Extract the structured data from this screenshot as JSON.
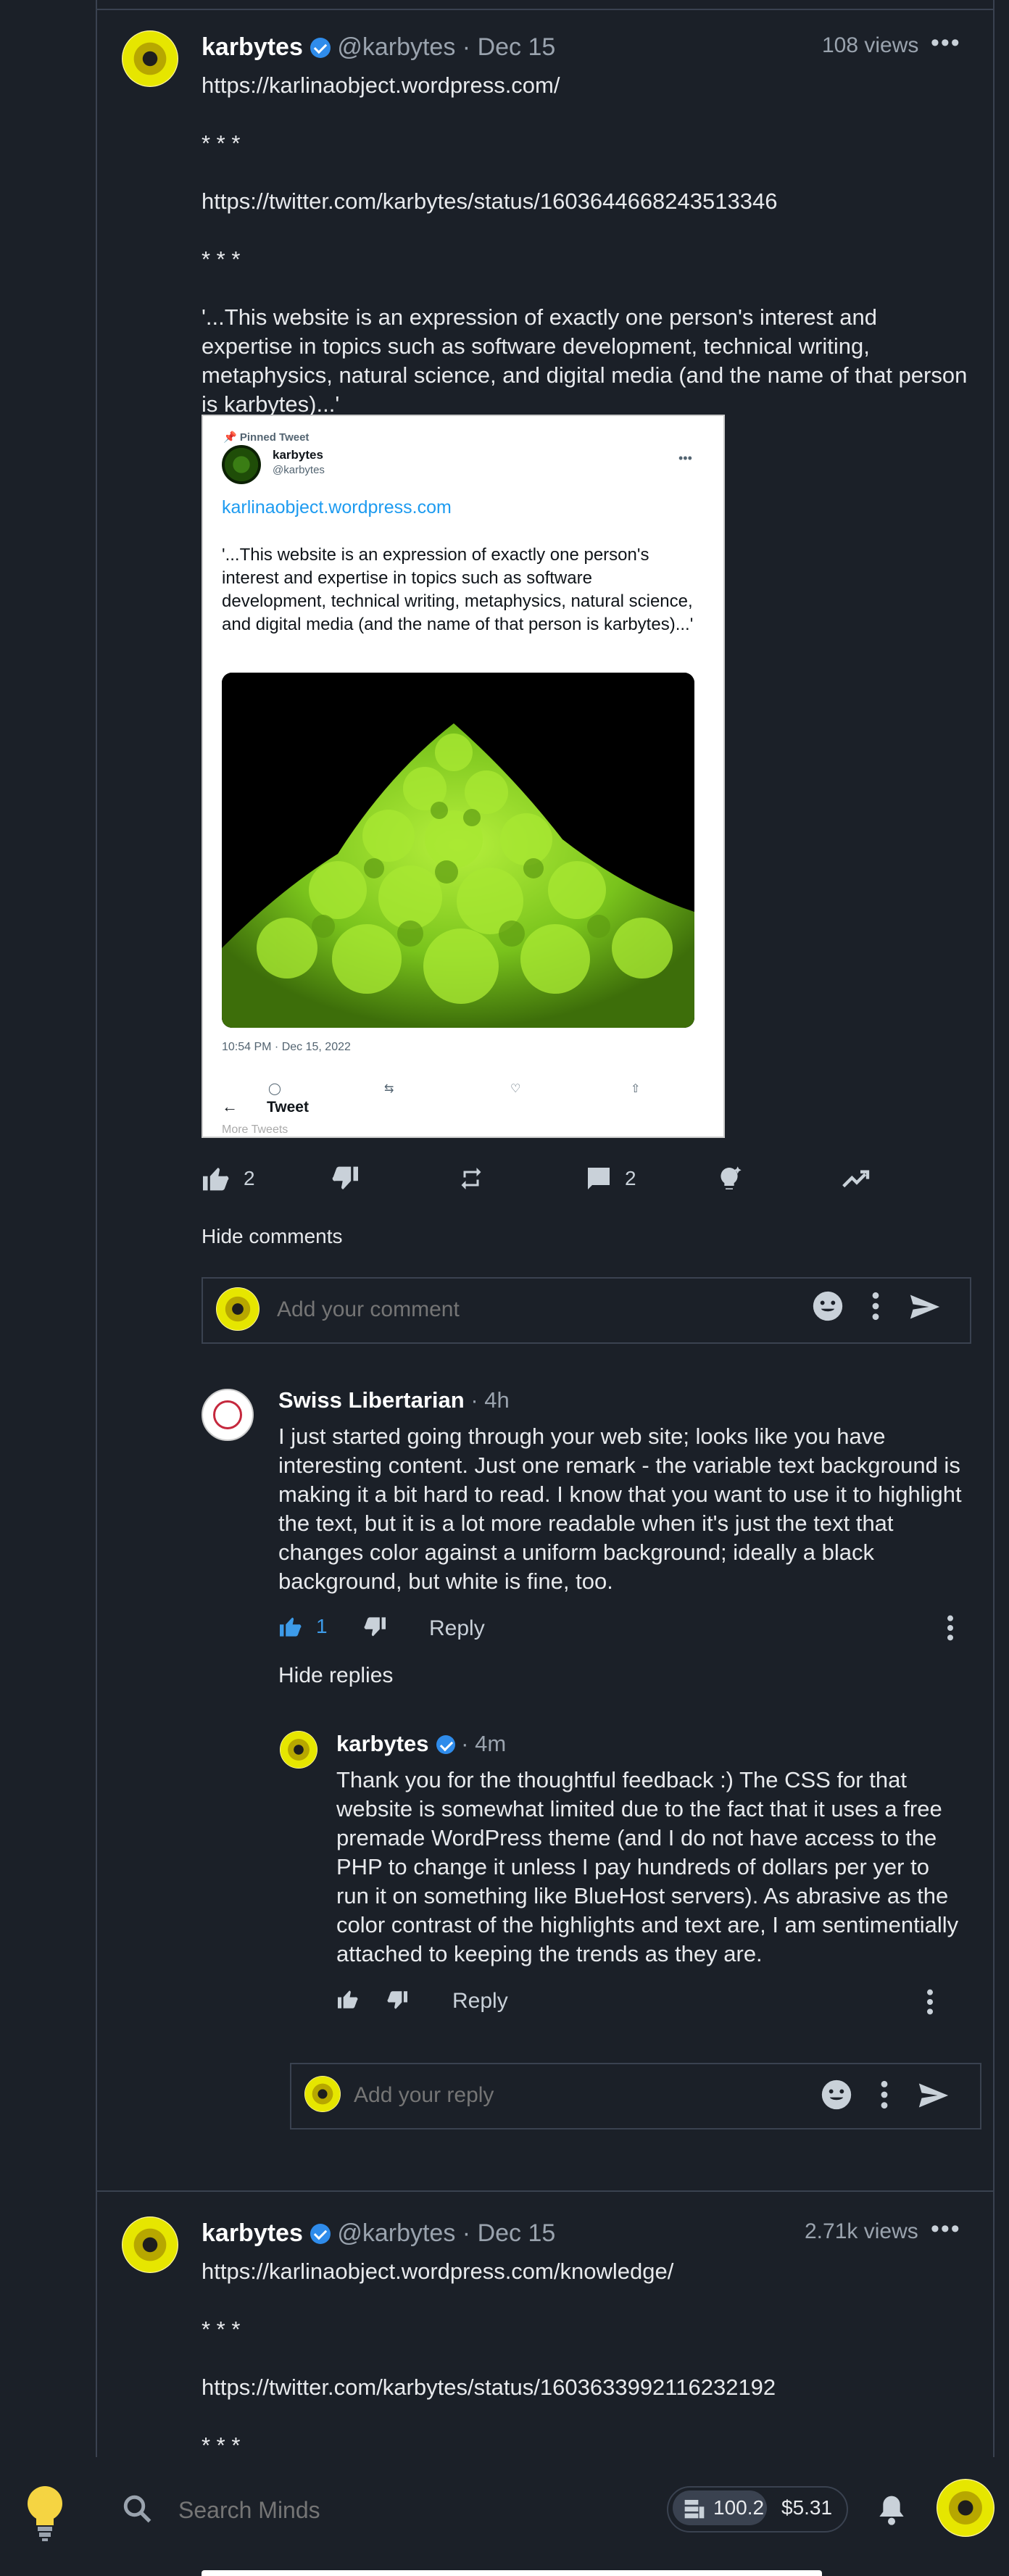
{
  "post1": {
    "author": "karbytes",
    "handle": "@karbytes",
    "date": "Dec 15",
    "views": "108 views",
    "link1": "https://karlinaobject.wordpress.com/",
    "sep1": "* * *",
    "link2": "https://twitter.com/karbytes/status/1603644668243513346",
    "sep2": "* * *",
    "body": "'...This website is an expression of exactly one person's interest and expertise in topics such as software development, technical writing, metaphysics, natural science, and digital media (and the name of that person is karbytes)...'",
    "embed": {
      "pinned": "Pinned Tweet",
      "name": "karbytes",
      "handle": "@karbytes",
      "link": "karlinaobject.wordpress.com",
      "body": "'...This website is an expression of exactly one person's interest and expertise in topics such as software development, technical writing, metaphysics, natural science, and digital media (and the name of that person is karbytes)...'",
      "timestamp": "10:54 PM · Dec 15, 2022",
      "back_title": "Tweet",
      "more": "More Tweets"
    },
    "actions": {
      "upvotes": "2",
      "comments": "2"
    },
    "hide_comments": "Hide comments",
    "comment_placeholder": "Add your comment"
  },
  "comment": {
    "author": "Swiss Libertarian",
    "time": "· 4h",
    "body": "I just started going through your web site; looks like you have interesting content. Just one remark - the variable text background is making it a bit hard to read. I know that you want to use it to highlight the text, but it is a lot more readable when it's just the text that changes color against a uniform background; ideally a black background, but white is fine, too.",
    "likes": "1",
    "reply": "Reply",
    "hide_replies": "Hide replies"
  },
  "reply": {
    "author": "karbytes",
    "time": "· 4m",
    "body": "Thank you for the thoughtful feedback :) The CSS for that website is somewhat limited due to the fact that it uses a free premade WordPress theme (and I do not have access to the PHP to change it unless I pay hundreds of dollars per yer to run it on something like BlueHost servers). As abrasive as the color contrast of the highlights and text are, I am sentimentially attached to keeping the trends as they are.",
    "reply": "Reply",
    "reply_placeholder": "Add your reply"
  },
  "post2": {
    "author": "karbytes",
    "handle": "@karbytes",
    "date": "Dec 15",
    "views": "2.71k views",
    "link1": "https://karlinaobject.wordpress.com/knowledge/",
    "sep1": "* * *",
    "link2": "https://twitter.com/karbytes/status/1603633992116232192",
    "sep2": "* * *"
  },
  "bottombar": {
    "search_placeholder": "Search Minds",
    "tokens": "100.2",
    "cash": "$5.31"
  },
  "icons": [
    "lightbulb-icon",
    "search-icon",
    "bell-icon",
    "thumbs-up-icon",
    "thumbs-down-icon",
    "remind-icon",
    "comment-icon",
    "boost-icon",
    "trending-icon",
    "emoji-icon",
    "send-icon",
    "kebab-icon"
  ],
  "colors": {
    "background": "#1b2028",
    "link": "#3d9be9",
    "accent": "#2f8ceb",
    "text": "#e8eaed",
    "muted": "#9aa3ae"
  }
}
